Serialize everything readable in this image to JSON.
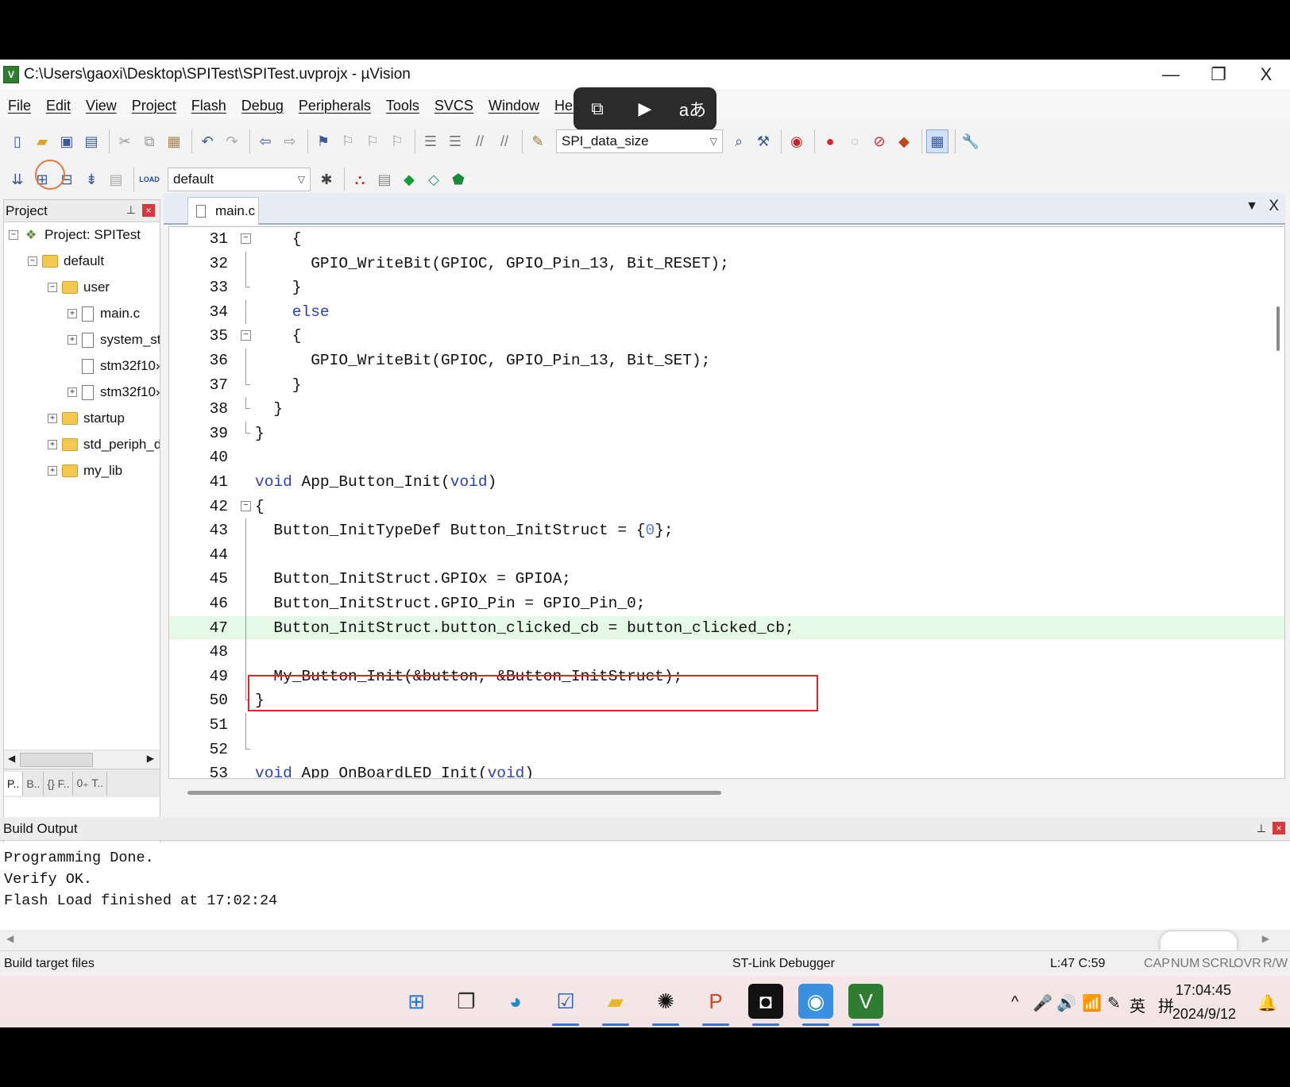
{
  "window": {
    "title": "C:\\Users\\gaoxi\\Desktop\\SPITest\\SPITest.uvprojx - µVision",
    "app_icon_letter": "V",
    "controls": {
      "minimize": "—",
      "restore": "❐",
      "close": "X"
    }
  },
  "menu": [
    "File",
    "Edit",
    "View",
    "Project",
    "Flash",
    "Debug",
    "Peripherals",
    "Tools",
    "SVCS",
    "Window",
    "Help"
  ],
  "media_overlay": {
    "pip": "⧉",
    "ai_video": "▶",
    "translate": "aあ"
  },
  "toolbar1": {
    "find_combo": "SPI_data_size"
  },
  "toolbar2": {
    "target_combo": "default",
    "load_label": "LOAD"
  },
  "project_panel": {
    "title": "Project",
    "pin": "⊥",
    "close": "×",
    "tree": [
      {
        "label": "Project: SPITest",
        "toggle": "−",
        "icon": "project"
      },
      {
        "label": "default",
        "toggle": "−",
        "icon": "folder"
      },
      {
        "label": "user",
        "toggle": "−",
        "icon": "folder"
      },
      {
        "label": "main.c",
        "toggle": "+",
        "icon": "file"
      },
      {
        "label": "system_st",
        "toggle": "+",
        "icon": "file"
      },
      {
        "label": "stm32f10›",
        "toggle": "",
        "icon": "file"
      },
      {
        "label": "stm32f10›",
        "toggle": "+",
        "icon": "file"
      },
      {
        "label": "startup",
        "toggle": "+",
        "icon": "folder"
      },
      {
        "label": "std_periph_dr",
        "toggle": "+",
        "icon": "folder"
      },
      {
        "label": "my_lib",
        "toggle": "+",
        "icon": "folder"
      }
    ],
    "tabs": [
      "P..",
      "B..",
      "{} F..",
      "0₊ T.."
    ]
  },
  "editor": {
    "tab": "main.c",
    "dropdown": "▼",
    "close": "X",
    "lines": [
      {
        "n": "31",
        "code": "    {"
      },
      {
        "n": "32",
        "code": "      GPIO_WriteBit(GPIOC, GPIO_Pin_13, Bit_RESET);"
      },
      {
        "n": "33",
        "code": "    }"
      },
      {
        "n": "34",
        "code": "    else"
      },
      {
        "n": "35",
        "code": "    {"
      },
      {
        "n": "36",
        "code": "      GPIO_WriteBit(GPIOC, GPIO_Pin_13, Bit_SET);"
      },
      {
        "n": "37",
        "code": "    }"
      },
      {
        "n": "38",
        "code": "  }"
      },
      {
        "n": "39",
        "code": "}"
      },
      {
        "n": "40",
        "code": ""
      },
      {
        "n": "41",
        "code": "void App_Button_Init(void)"
      },
      {
        "n": "42",
        "code": "{"
      },
      {
        "n": "43",
        "code": "  Button_InitTypeDef Button_InitStruct = {0};"
      },
      {
        "n": "44",
        "code": ""
      },
      {
        "n": "45",
        "code": "  Button_InitStruct.GPIOx = GPIOA;"
      },
      {
        "n": "46",
        "code": "  Button_InitStruct.GPIO_Pin = GPIO_Pin_0;"
      },
      {
        "n": "47",
        "code": "  Button_InitStruct.button_clicked_cb = button_clicked_cb;"
      },
      {
        "n": "48",
        "code": ""
      },
      {
        "n": "49",
        "code": "  My_Button_Init(&button, &Button_InitStruct);"
      },
      {
        "n": "50",
        "code": "}"
      },
      {
        "n": "51",
        "code": ""
      },
      {
        "n": "52",
        "code": ""
      },
      {
        "n": "53",
        "code": "void App_OnBoardLED_Init(void)"
      }
    ]
  },
  "build_output": {
    "title": "Build Output",
    "lines": [
      "Programming Done.",
      "Verify OK.",
      "Flash Load finished at 17:02:24"
    ]
  },
  "status_bar": {
    "left": "Build target files",
    "debugger": "ST-Link Debugger",
    "position": "L:47 C:59",
    "flags": [
      "CAP",
      "NUM",
      "SCRL",
      "OVR",
      "R/W"
    ]
  },
  "taskbar": {
    "time": "17:04:45",
    "date": "2024/9/12",
    "tray": [
      "^",
      "🎤",
      "🔊",
      "📶",
      "✎",
      "英",
      "拼"
    ]
  },
  "colors": {
    "keyword": "#2a3fbf",
    "highlight_line": "#e6f9e6",
    "annotation_box": "#e0242a"
  }
}
